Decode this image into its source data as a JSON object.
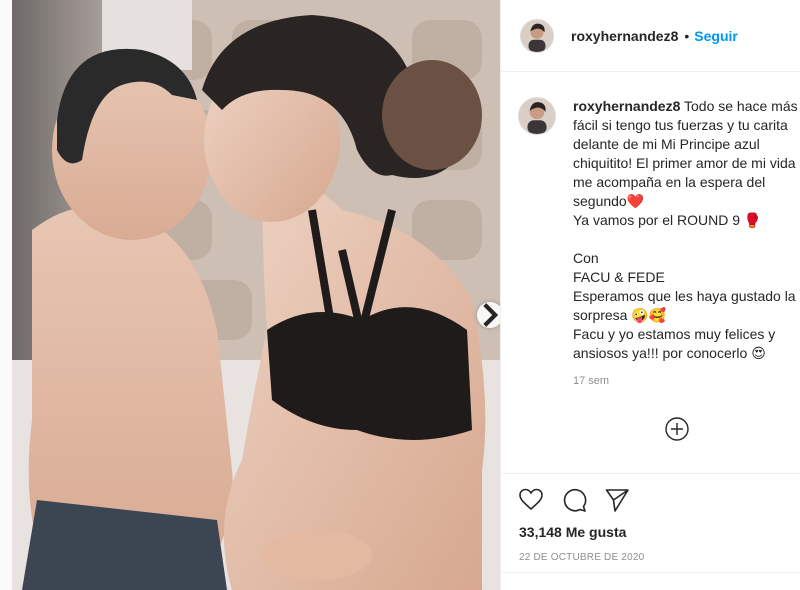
{
  "post": {
    "username": "roxyhernandez8",
    "separator": "•",
    "follow_label": "Seguir"
  },
  "caption": {
    "username": "roxyhernandez8",
    "text": " Todo se hace más fácil si tengo tus fuerzas y tu carita delante de mi Mi Principe azul chiquitito! El primer amor de mi vida me acompaña en la espera del segundo❤️\nYa vamos por el ROUND 9 🥊\n\nCon\nFACU & FEDE\nEsperamos que les haya gustado la sorpresa 🤪🥰\nFacu y yo estamos muy felices y ansiosos ya!!! por conocerlo 😍",
    "time": "17 sem"
  },
  "stats": {
    "likes": "33,148 Me gusta",
    "date": "22 DE OCTUBRE DE 2020"
  },
  "icons": {
    "like": "heart-icon",
    "comment": "comment-icon",
    "share": "send-icon",
    "more": "plus-circle-icon",
    "next": "chevron-right-icon"
  },
  "colors": {
    "link": "#0095f6",
    "text": "#262626",
    "muted": "#8e8e8e",
    "border": "#efefef"
  }
}
